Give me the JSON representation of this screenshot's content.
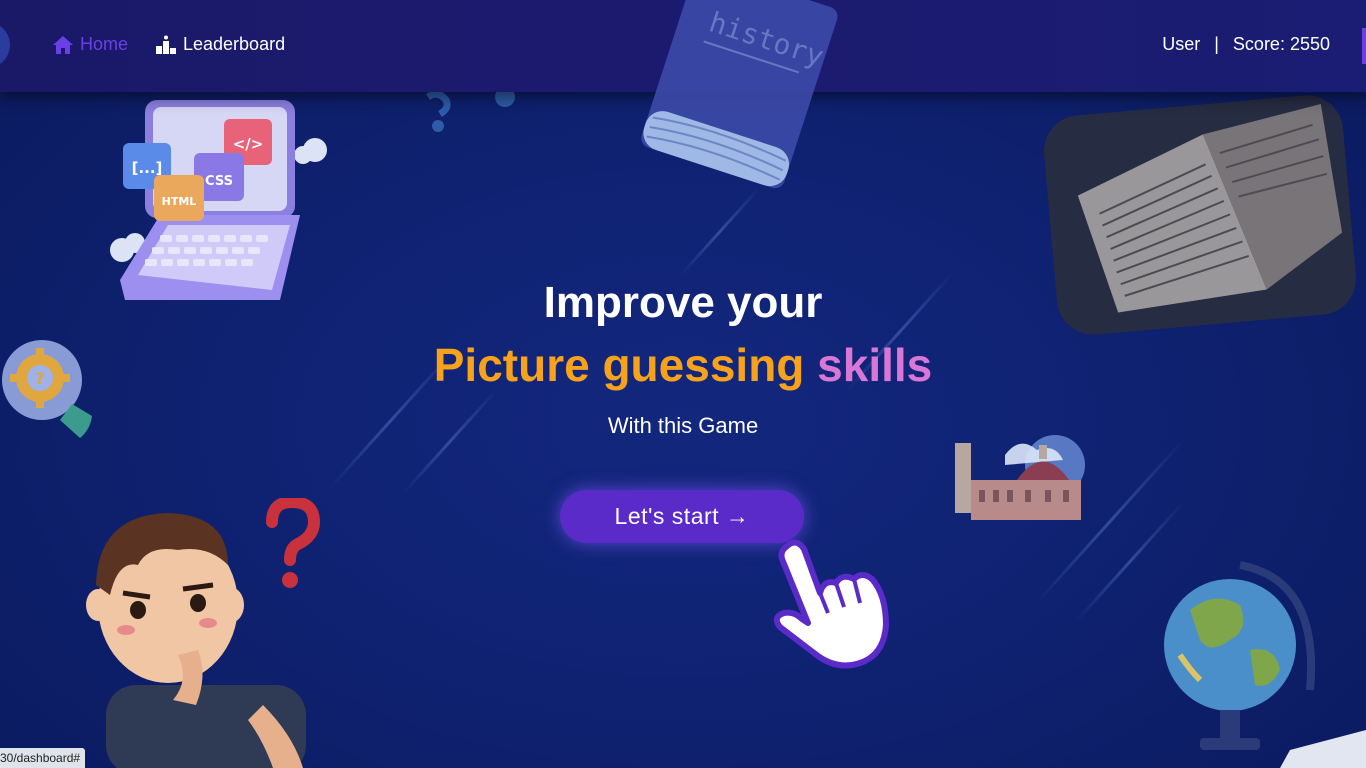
{
  "nav": {
    "home_label": "Home",
    "leaderboard_label": "Leaderboard",
    "user_label": "User",
    "separator": "|",
    "score_label": "Score: 2550",
    "home_color": "#6a3fe8"
  },
  "hero": {
    "line1": "Improve your",
    "line2_orange": "Picture guessing",
    "line2_pink": "skills",
    "subtitle": "With this Game",
    "cta_label": "Let's start →"
  },
  "decor": {
    "book_text": "history",
    "laptop_tags": [
      "[...]",
      "</>",
      "CSS",
      "HTML"
    ]
  },
  "status_bar": {
    "url": "30/dashboard#"
  },
  "colors": {
    "accent": "#5a2bc9",
    "orange": "#f7a21b",
    "pink": "#d877d6",
    "background": "#0f2272"
  },
  "icons": [
    "home-icon",
    "podium-icon",
    "hand-pointer-icon",
    "question-mark-icon",
    "lightbulb-gear-icon",
    "globe-icon"
  ]
}
